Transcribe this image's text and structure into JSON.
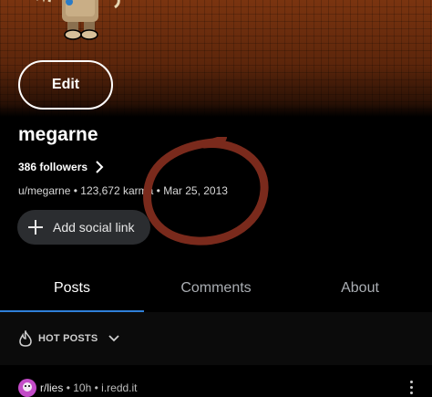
{
  "profile": {
    "edit_label": "Edit",
    "username": "megarne",
    "followers_label": "386 followers",
    "handle": "u/megarne",
    "karma": "123,672 karma",
    "cake_day": "Mar 25, 2013",
    "separator": "•",
    "add_social_label": "Add social link"
  },
  "tabs": [
    {
      "label": "Posts",
      "active": true
    },
    {
      "label": "Comments",
      "active": false
    },
    {
      "label": "About",
      "active": false
    }
  ],
  "sort": {
    "label": "HOT POSTS"
  },
  "post": {
    "subreddit": "r/lies",
    "age": "10h",
    "domain": "i.redd.it",
    "separator": "•"
  },
  "colors": {
    "accent": "#2f7fd8",
    "header": "#6b2d0d",
    "annotation": "#7a2a1c"
  },
  "icons": {
    "social": "plus-icon",
    "followers": "chevron-right-icon",
    "sort": "flame-icon",
    "sort_menu": "chevron-down-icon",
    "post_menu": "kebab-icon"
  }
}
